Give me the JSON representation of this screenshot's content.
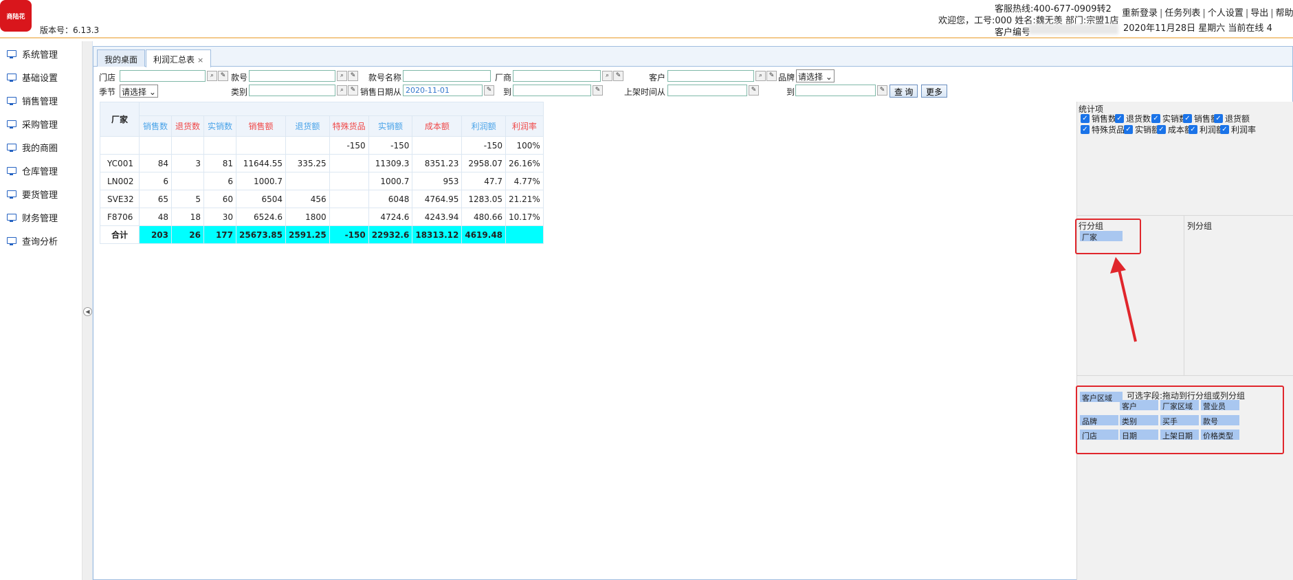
{
  "header": {
    "logo_text": "商陆花",
    "version": "版本号：6.13.3",
    "hotline": "客服热线:400-677-0909转2",
    "welcome": "欢迎您，工号:000 姓名:魏无羡 部门:宗盟1店",
    "customer_no_label": "客户编号",
    "links": [
      "重新登录",
      "任务列表",
      "个人设置",
      "导出",
      "帮助"
    ],
    "datetime": "2020年11月28日 星期六 当前在线 4"
  },
  "sidebar": {
    "items": [
      {
        "label": "系统管理",
        "icon": "monitor-icon"
      },
      {
        "label": "基础设置",
        "icon": "monitor-icon"
      },
      {
        "label": "销售管理",
        "icon": "monitor-icon"
      },
      {
        "label": "采购管理",
        "icon": "monitor-icon"
      },
      {
        "label": "我的商圈",
        "icon": "monitor-icon"
      },
      {
        "label": "仓库管理",
        "icon": "monitor-icon"
      },
      {
        "label": "要货管理",
        "icon": "monitor-icon"
      },
      {
        "label": "财务管理",
        "icon": "monitor-icon"
      },
      {
        "label": "查询分析",
        "icon": "monitor-icon"
      }
    ]
  },
  "tabs": [
    {
      "label": "我的桌面",
      "active": false
    },
    {
      "label": "利润汇总表",
      "active": true,
      "close": "×"
    }
  ],
  "filters": {
    "store_label": "门店",
    "style_no_label": "款号",
    "style_name_label": "款号名称",
    "vendor_label": "厂商",
    "customer_label": "客户",
    "brand_label": "品牌",
    "brand_value": "请选择",
    "season_label": "季节",
    "season_value": "请选择",
    "category_label": "类别",
    "sale_date_from_label": "销售日期从",
    "sale_date_from_value": "2020-11-01",
    "to_label": "到",
    "shelf_time_from_label": "上架时间从",
    "to_label2": "到",
    "query_button": "查 询",
    "more_button": "更多"
  },
  "table": {
    "row_group_header": "厂家",
    "columns": [
      {
        "label": "销售数",
        "color": "blue"
      },
      {
        "label": "退货数",
        "color": "red"
      },
      {
        "label": "实销数",
        "color": "blue"
      },
      {
        "label": "销售额",
        "color": "red"
      },
      {
        "label": "退货额",
        "color": "blue"
      },
      {
        "label": "特殊货品",
        "color": "red"
      },
      {
        "label": "实销额",
        "color": "blue"
      },
      {
        "label": "成本额",
        "color": "red"
      },
      {
        "label": "利润额",
        "color": "blue"
      },
      {
        "label": "利润率",
        "color": "red"
      }
    ],
    "rows": [
      {
        "name": "",
        "cells": [
          "",
          "",
          "",
          "",
          "",
          "-150",
          "-150",
          "",
          "-150",
          "100%"
        ]
      },
      {
        "name": "YC001",
        "cells": [
          "84",
          "3",
          "81",
          "11644.55",
          "335.25",
          "",
          "11309.3",
          "8351.23",
          "2958.07",
          "26.16%"
        ]
      },
      {
        "name": "LN002",
        "cells": [
          "6",
          "",
          "6",
          "1000.7",
          "",
          "",
          "1000.7",
          "953",
          "47.7",
          "4.77%"
        ]
      },
      {
        "name": "SVE32",
        "cells": [
          "65",
          "5",
          "60",
          "6504",
          "456",
          "",
          "6048",
          "4764.95",
          "1283.05",
          "21.21%"
        ]
      },
      {
        "name": "F8706",
        "cells": [
          "48",
          "18",
          "30",
          "6524.6",
          "1800",
          "",
          "4724.6",
          "4243.94",
          "480.66",
          "10.17%"
        ]
      }
    ],
    "total": {
      "name": "合计",
      "cells": [
        "203",
        "26",
        "177",
        "25673.85",
        "2591.25",
        "-150",
        "22932.6",
        "18313.12",
        "4619.48",
        ""
      ]
    }
  },
  "config": {
    "stats_title": "统计项",
    "stats_items": [
      "销售数",
      "退货数",
      "实销数",
      "销售额",
      "退货额",
      "特殊货品",
      "实销额",
      "成本额",
      "利润额",
      "利润率"
    ],
    "row_group_label": "行分组",
    "row_group_chip": "厂家",
    "col_group_label": "列分组",
    "available_hint": "可选字段:拖动到行分组或列分组",
    "available_first": "客户区域",
    "available_fields": [
      "客户",
      "厂家区域",
      "营业员",
      "品牌",
      "类别",
      "买手",
      "款号",
      "门店",
      "日期",
      "上架日期",
      "价格类型"
    ]
  },
  "colors": {
    "accent_blue": "#4aa3e8",
    "accent_red": "#f04848",
    "total_row": "#00ffff",
    "chip": "#a9c7f0",
    "annotation_red": "#e0262c"
  }
}
